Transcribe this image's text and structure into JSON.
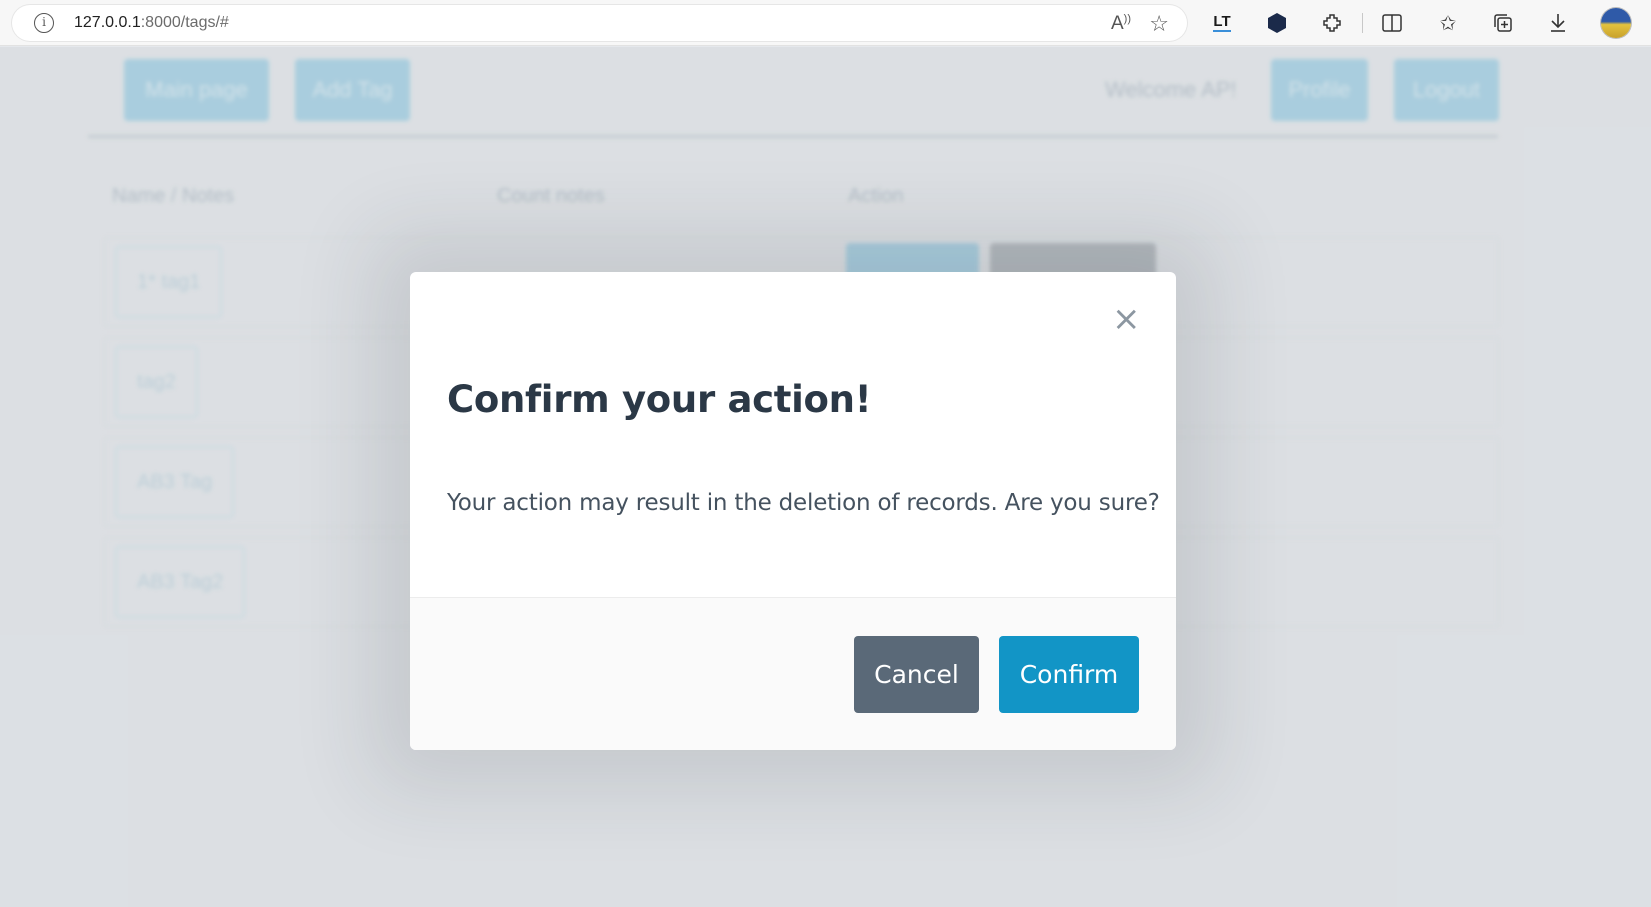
{
  "browser": {
    "url_host": "127.0.0.1",
    "url_path": ":8000/tags/#",
    "toolbar_icons": [
      "read-aloud-icon",
      "favorite-star-icon",
      "languagetool-icon",
      "extension-hex-icon",
      "extensions-icon",
      "split-screen-icon",
      "favorites-icon",
      "collections-icon",
      "downloads-icon",
      "profile-avatar"
    ]
  },
  "background": {
    "nav_buttons": [
      "Main page",
      "Add Tag"
    ],
    "welcome": "Welcome AP!",
    "right_buttons": [
      "Profile",
      "Logout"
    ],
    "table_headers": [
      "Name / Notes",
      "Count notes",
      "Action"
    ],
    "tags": [
      "1* tag1",
      "tag2",
      "AB3 Tag",
      "AB3 Tag2"
    ]
  },
  "modal": {
    "close_symbol": "×",
    "title": "Confirm your action!",
    "body": "Your action may result in the deletion of records. Are you sure?",
    "cancel_label": "Cancel",
    "confirm_label": "Confirm"
  },
  "colors": {
    "primary": "#1295c6",
    "secondary": "#5a6978",
    "title_text": "#2b3846"
  }
}
